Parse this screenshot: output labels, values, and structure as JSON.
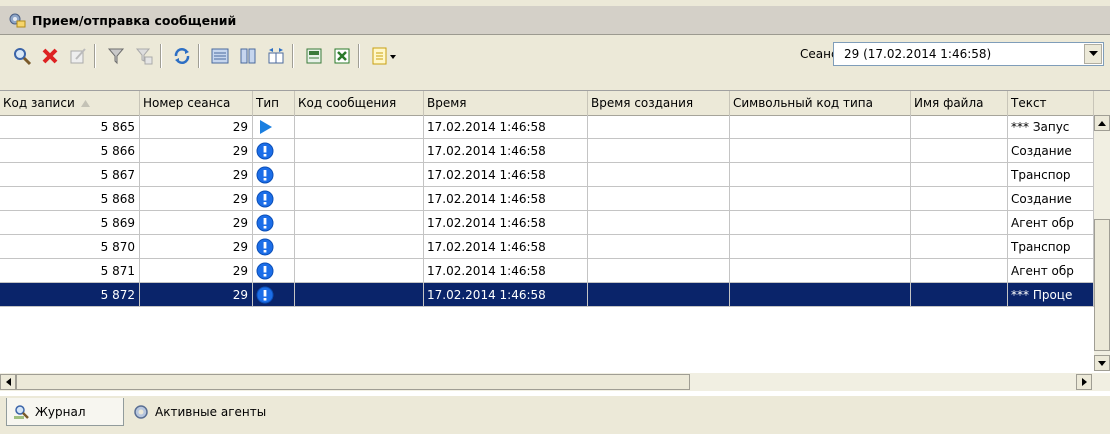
{
  "window": {
    "title": "Прием/отправка сообщений"
  },
  "toolbar": {
    "icons": [
      "search-icon",
      "delete-icon",
      "edit-icon",
      "filter-icon",
      "filter-clear-icon",
      "refresh-icon",
      "list-icon",
      "columns-icon",
      "autosize-icon",
      "export-icon",
      "excel-icon",
      "report-dropdown-icon"
    ],
    "session_label": "Сеанс:",
    "session_value": "29 (17.02.2014 1:46:58)"
  },
  "grid": {
    "columns": [
      "Код записи",
      "Номер сеанса",
      "Тип",
      "Код сообщения",
      "Время",
      "Время создания",
      "Символьный код типа",
      "Имя файла",
      "Текст"
    ],
    "rows": [
      {
        "id": "5 865",
        "session": "29",
        "type": "play",
        "code": "",
        "time": "17.02.2014 1:46:58",
        "created": "",
        "type_code": "",
        "file": "",
        "text": "*** Запус"
      },
      {
        "id": "5 866",
        "session": "29",
        "type": "info",
        "code": "",
        "time": "17.02.2014 1:46:58",
        "created": "",
        "type_code": "",
        "file": "",
        "text": "Создание"
      },
      {
        "id": "5 867",
        "session": "29",
        "type": "info",
        "code": "",
        "time": "17.02.2014 1:46:58",
        "created": "",
        "type_code": "",
        "file": "",
        "text": "Транспор"
      },
      {
        "id": "5 868",
        "session": "29",
        "type": "info",
        "code": "",
        "time": "17.02.2014 1:46:58",
        "created": "",
        "type_code": "",
        "file": "",
        "text": "Создание"
      },
      {
        "id": "5 869",
        "session": "29",
        "type": "info",
        "code": "",
        "time": "17.02.2014 1:46:58",
        "created": "",
        "type_code": "",
        "file": "",
        "text": "Агент обр"
      },
      {
        "id": "5 870",
        "session": "29",
        "type": "info",
        "code": "",
        "time": "17.02.2014 1:46:58",
        "created": "",
        "type_code": "",
        "file": "",
        "text": "Транспор"
      },
      {
        "id": "5 871",
        "session": "29",
        "type": "info",
        "code": "",
        "time": "17.02.2014 1:46:58",
        "created": "",
        "type_code": "",
        "file": "",
        "text": "Агент обр"
      },
      {
        "id": "5 872",
        "session": "29",
        "type": "info",
        "code": "",
        "time": "17.02.2014 1:46:58",
        "created": "",
        "type_code": "",
        "file": "",
        "text": "*** Проце"
      }
    ],
    "selected_row": 7
  },
  "tabs": [
    {
      "label": "Журнал",
      "icon": "journal-icon",
      "active": true
    },
    {
      "label": "Активные агенты",
      "icon": "gear-icon",
      "active": false
    }
  ],
  "colors": {
    "selection": "#0a246a",
    "info_icon": "#1c6ee8",
    "play_icon": "#1b7fe0"
  }
}
